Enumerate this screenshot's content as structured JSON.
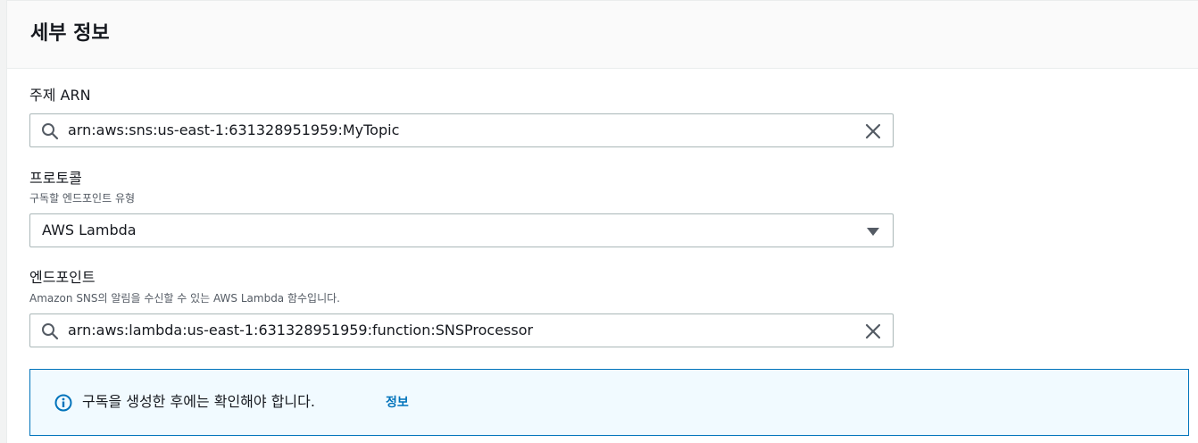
{
  "panel": {
    "title": "세부 정보"
  },
  "topic_arn": {
    "label": "주제 ARN",
    "value": "arn:aws:sns:us-east-1:631328951959:MyTopic",
    "lead_icon": "search-icon",
    "clear_icon": "close-icon"
  },
  "protocol": {
    "label": "프로토콜",
    "description": "구독할 엔드포인트 유형",
    "selected": "AWS Lambda",
    "dropdown_icon": "caret-down-icon"
  },
  "endpoint": {
    "label": "엔드포인트",
    "description": "Amazon SNS의 알림을 수신할 수 있는 AWS Lambda 함수입니다.",
    "value": "arn:aws:lambda:us-east-1:631328951959:function:SNSProcessor",
    "lead_icon": "search-icon",
    "clear_icon": "close-icon"
  },
  "alert": {
    "icon": "info-icon",
    "message": "구독을 생성한 후에는 확인해야 합니다.",
    "link_label": "정보"
  },
  "colors": {
    "accent": "#0073bb",
    "alert_background": "#f1faff",
    "input_border": "#aab7b8",
    "text_primary": "#16191f",
    "text_secondary": "#545b64"
  }
}
